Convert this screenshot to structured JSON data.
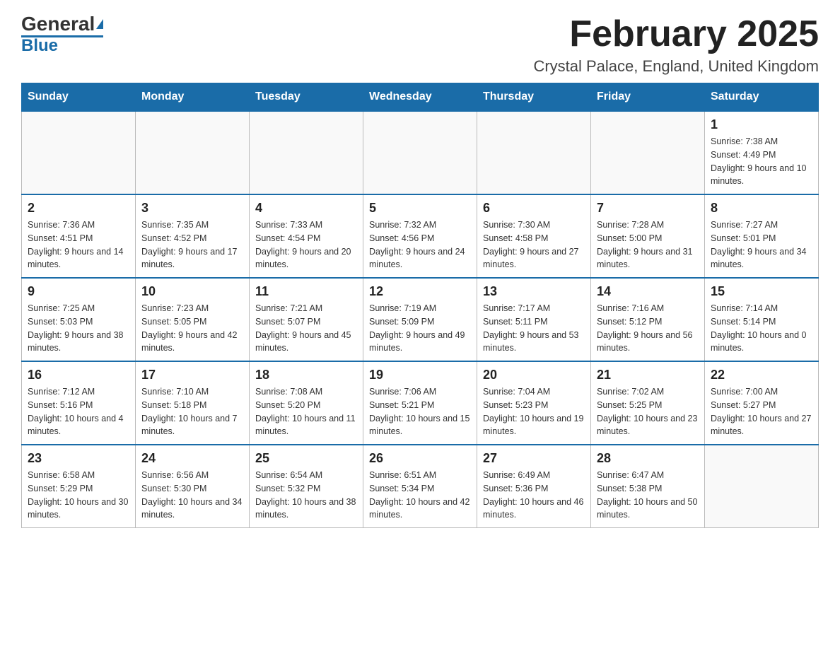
{
  "logo": {
    "text_general": "General",
    "text_blue": "Blue"
  },
  "header": {
    "title": "February 2025",
    "subtitle": "Crystal Palace, England, United Kingdom"
  },
  "days_of_week": [
    "Sunday",
    "Monday",
    "Tuesday",
    "Wednesday",
    "Thursday",
    "Friday",
    "Saturday"
  ],
  "weeks": [
    [
      {
        "num": "",
        "info": ""
      },
      {
        "num": "",
        "info": ""
      },
      {
        "num": "",
        "info": ""
      },
      {
        "num": "",
        "info": ""
      },
      {
        "num": "",
        "info": ""
      },
      {
        "num": "",
        "info": ""
      },
      {
        "num": "1",
        "info": "Sunrise: 7:38 AM\nSunset: 4:49 PM\nDaylight: 9 hours and 10 minutes."
      }
    ],
    [
      {
        "num": "2",
        "info": "Sunrise: 7:36 AM\nSunset: 4:51 PM\nDaylight: 9 hours and 14 minutes."
      },
      {
        "num": "3",
        "info": "Sunrise: 7:35 AM\nSunset: 4:52 PM\nDaylight: 9 hours and 17 minutes."
      },
      {
        "num": "4",
        "info": "Sunrise: 7:33 AM\nSunset: 4:54 PM\nDaylight: 9 hours and 20 minutes."
      },
      {
        "num": "5",
        "info": "Sunrise: 7:32 AM\nSunset: 4:56 PM\nDaylight: 9 hours and 24 minutes."
      },
      {
        "num": "6",
        "info": "Sunrise: 7:30 AM\nSunset: 4:58 PM\nDaylight: 9 hours and 27 minutes."
      },
      {
        "num": "7",
        "info": "Sunrise: 7:28 AM\nSunset: 5:00 PM\nDaylight: 9 hours and 31 minutes."
      },
      {
        "num": "8",
        "info": "Sunrise: 7:27 AM\nSunset: 5:01 PM\nDaylight: 9 hours and 34 minutes."
      }
    ],
    [
      {
        "num": "9",
        "info": "Sunrise: 7:25 AM\nSunset: 5:03 PM\nDaylight: 9 hours and 38 minutes."
      },
      {
        "num": "10",
        "info": "Sunrise: 7:23 AM\nSunset: 5:05 PM\nDaylight: 9 hours and 42 minutes."
      },
      {
        "num": "11",
        "info": "Sunrise: 7:21 AM\nSunset: 5:07 PM\nDaylight: 9 hours and 45 minutes."
      },
      {
        "num": "12",
        "info": "Sunrise: 7:19 AM\nSunset: 5:09 PM\nDaylight: 9 hours and 49 minutes."
      },
      {
        "num": "13",
        "info": "Sunrise: 7:17 AM\nSunset: 5:11 PM\nDaylight: 9 hours and 53 minutes."
      },
      {
        "num": "14",
        "info": "Sunrise: 7:16 AM\nSunset: 5:12 PM\nDaylight: 9 hours and 56 minutes."
      },
      {
        "num": "15",
        "info": "Sunrise: 7:14 AM\nSunset: 5:14 PM\nDaylight: 10 hours and 0 minutes."
      }
    ],
    [
      {
        "num": "16",
        "info": "Sunrise: 7:12 AM\nSunset: 5:16 PM\nDaylight: 10 hours and 4 minutes."
      },
      {
        "num": "17",
        "info": "Sunrise: 7:10 AM\nSunset: 5:18 PM\nDaylight: 10 hours and 7 minutes."
      },
      {
        "num": "18",
        "info": "Sunrise: 7:08 AM\nSunset: 5:20 PM\nDaylight: 10 hours and 11 minutes."
      },
      {
        "num": "19",
        "info": "Sunrise: 7:06 AM\nSunset: 5:21 PM\nDaylight: 10 hours and 15 minutes."
      },
      {
        "num": "20",
        "info": "Sunrise: 7:04 AM\nSunset: 5:23 PM\nDaylight: 10 hours and 19 minutes."
      },
      {
        "num": "21",
        "info": "Sunrise: 7:02 AM\nSunset: 5:25 PM\nDaylight: 10 hours and 23 minutes."
      },
      {
        "num": "22",
        "info": "Sunrise: 7:00 AM\nSunset: 5:27 PM\nDaylight: 10 hours and 27 minutes."
      }
    ],
    [
      {
        "num": "23",
        "info": "Sunrise: 6:58 AM\nSunset: 5:29 PM\nDaylight: 10 hours and 30 minutes."
      },
      {
        "num": "24",
        "info": "Sunrise: 6:56 AM\nSunset: 5:30 PM\nDaylight: 10 hours and 34 minutes."
      },
      {
        "num": "25",
        "info": "Sunrise: 6:54 AM\nSunset: 5:32 PM\nDaylight: 10 hours and 38 minutes."
      },
      {
        "num": "26",
        "info": "Sunrise: 6:51 AM\nSunset: 5:34 PM\nDaylight: 10 hours and 42 minutes."
      },
      {
        "num": "27",
        "info": "Sunrise: 6:49 AM\nSunset: 5:36 PM\nDaylight: 10 hours and 46 minutes."
      },
      {
        "num": "28",
        "info": "Sunrise: 6:47 AM\nSunset: 5:38 PM\nDaylight: 10 hours and 50 minutes."
      },
      {
        "num": "",
        "info": ""
      }
    ]
  ]
}
